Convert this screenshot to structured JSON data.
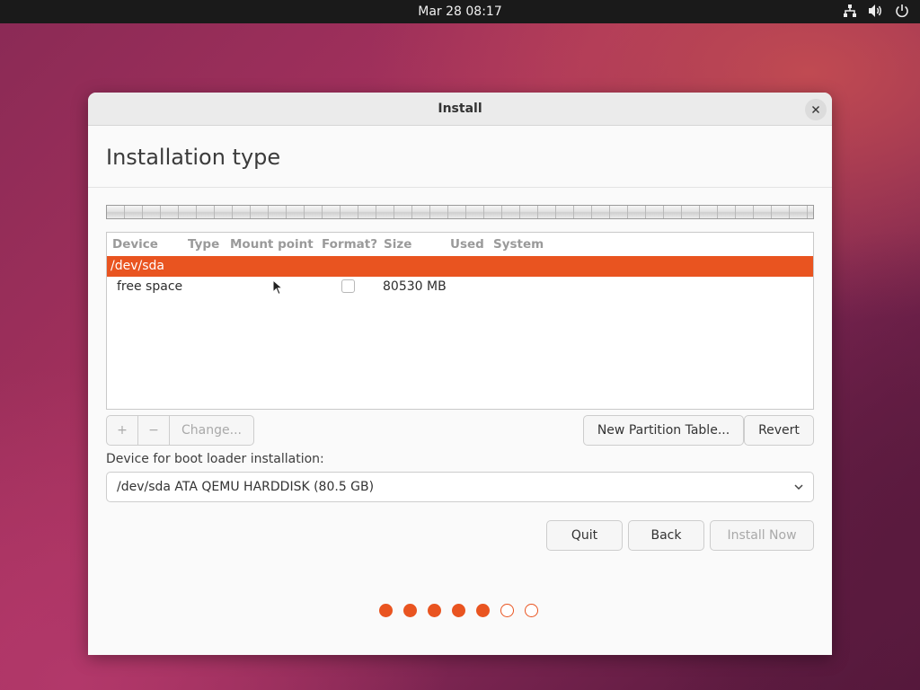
{
  "topbar": {
    "clock": "Mar 28  08:17",
    "icons": [
      "network-icon",
      "volume-icon",
      "power-icon"
    ]
  },
  "window": {
    "title": "Install",
    "page_title": "Installation type"
  },
  "table": {
    "columns": [
      "Device",
      "Type",
      "Mount point",
      "Format?",
      "Size",
      "Used",
      "System"
    ],
    "rows": [
      {
        "device": "/dev/sda",
        "selected": true
      },
      {
        "device": "free space",
        "format": false,
        "size": "80530 MB",
        "selected": false
      }
    ]
  },
  "actions": {
    "add_label": "+",
    "remove_label": "−",
    "change_label": "Change...",
    "new_table_label": "New Partition Table...",
    "revert_label": "Revert"
  },
  "bootloader": {
    "label": "Device for boot loader installation:",
    "selected": "/dev/sda ATA QEMU HARDDISK (80.5 GB)"
  },
  "nav": {
    "quit_label": "Quit",
    "back_label": "Back",
    "install_label": "Install Now"
  },
  "steps": {
    "total": 7,
    "completed": 5
  },
  "colors": {
    "accent": "#e95420",
    "topbar": "#1a1a1a"
  }
}
